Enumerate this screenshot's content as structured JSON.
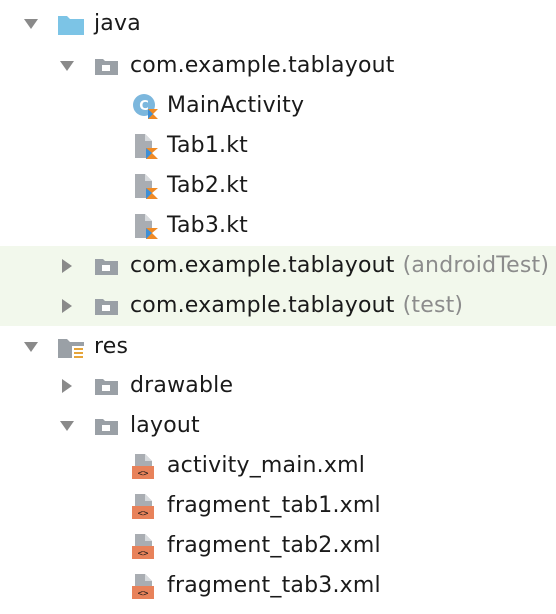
{
  "tree": {
    "java": {
      "label": "java",
      "expanded": true,
      "icon": "folder-icon",
      "color": "#7cc4e6"
    },
    "pkg_main": {
      "label": "com.example.tablayout",
      "expanded": true,
      "icon": "package-icon"
    },
    "main_activity": {
      "label": "MainActivity",
      "icon": "kotlin-class-icon"
    },
    "tab1": {
      "label": "Tab1.kt",
      "icon": "kotlin-file-icon"
    },
    "tab2": {
      "label": "Tab2.kt",
      "icon": "kotlin-file-icon"
    },
    "tab3": {
      "label": "Tab3.kt",
      "icon": "kotlin-file-icon"
    },
    "pkg_android_test": {
      "label": "com.example.tablayout",
      "suffix": "(androidTest)",
      "expanded": false,
      "icon": "package-icon"
    },
    "pkg_test": {
      "label": "com.example.tablayout",
      "suffix": "(test)",
      "expanded": false,
      "icon": "package-icon"
    },
    "res": {
      "label": "res",
      "expanded": true,
      "icon": "resource-folder-icon"
    },
    "drawable": {
      "label": "drawable",
      "expanded": false,
      "icon": "package-icon"
    },
    "layout": {
      "label": "layout",
      "expanded": true,
      "icon": "package-icon"
    },
    "activity_main": {
      "label": "activity_main.xml",
      "icon": "xml-layout-icon"
    },
    "fragment_tab1": {
      "label": "fragment_tab1.xml",
      "icon": "xml-layout-icon"
    },
    "fragment_tab2": {
      "label": "fragment_tab2.xml",
      "icon": "xml-layout-icon"
    },
    "fragment_tab3": {
      "label": "fragment_tab3.xml",
      "icon": "xml-layout-icon"
    }
  },
  "colors": {
    "highlight": "#f2f8ec",
    "arrow": "#8a8a8a",
    "package_folder": "#9aa0a6",
    "kotlin_orange": "#f08a24",
    "kotlin_blue": "#3d8fd6",
    "xml_orange": "#e8825a"
  }
}
